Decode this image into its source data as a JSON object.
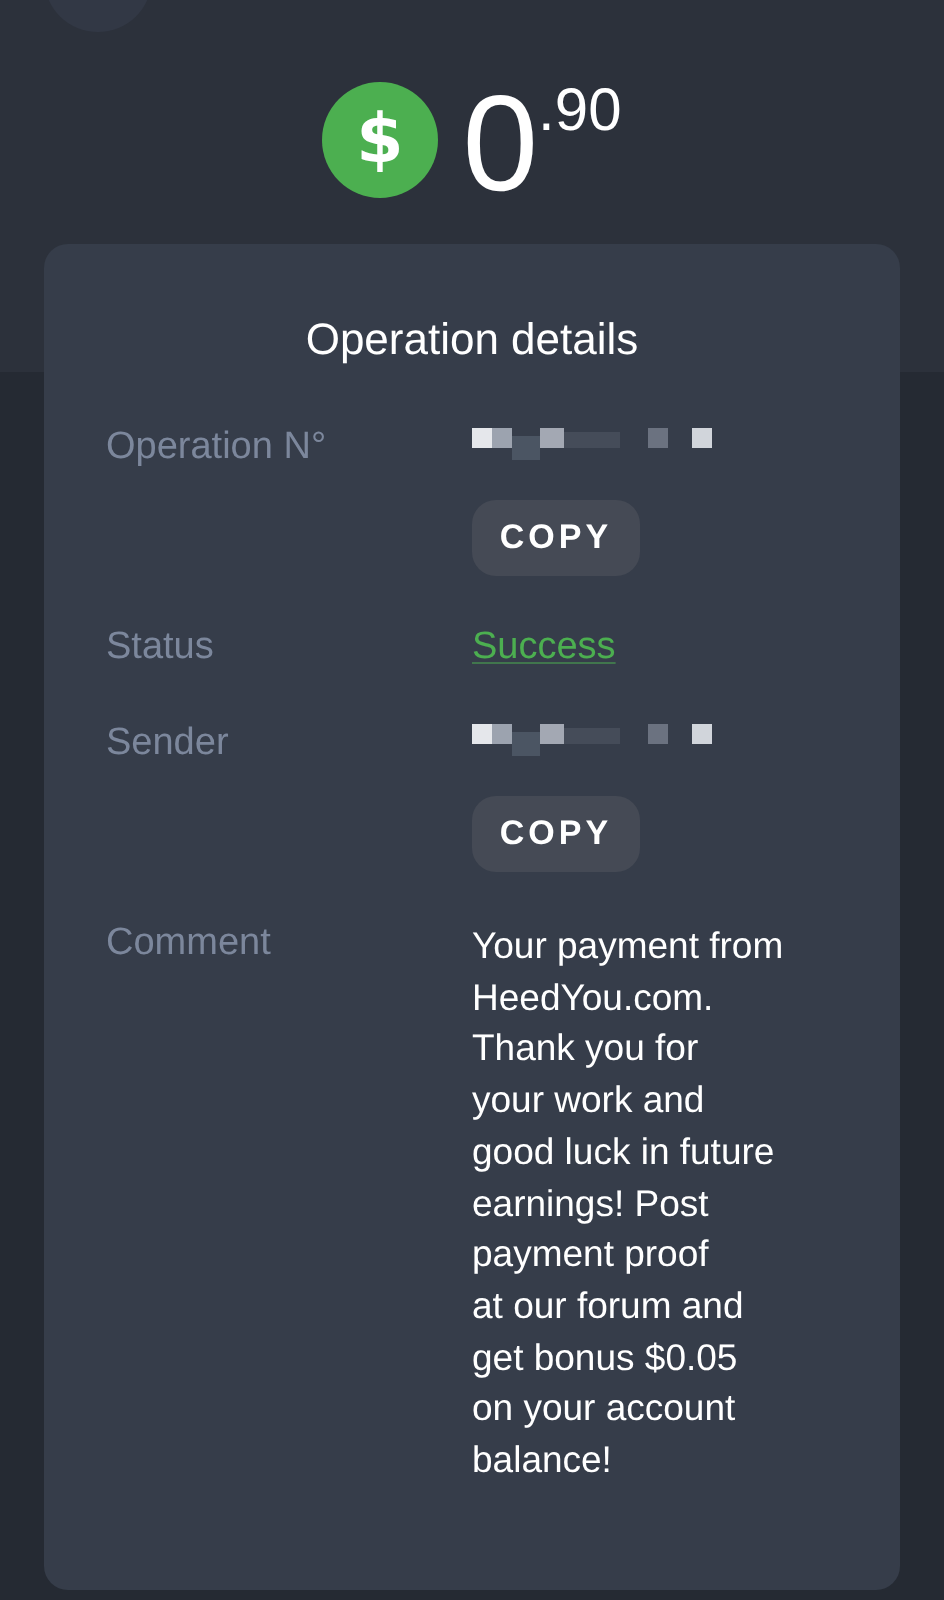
{
  "amount": {
    "currency_symbol": "$",
    "integer": "0",
    "fraction": ".90"
  },
  "card": {
    "title": "Operation details",
    "rows": [
      {
        "kind": "redacted",
        "label": "Operation N°",
        "copy": "COPY"
      },
      {
        "kind": "status",
        "label": "Status",
        "value": "Success"
      },
      {
        "kind": "redacted",
        "label": "Sender",
        "copy": "COPY"
      },
      {
        "kind": "text",
        "label": "Comment",
        "lines": [
          "Your payment from",
          "HeedYou.com.",
          "Thank you for",
          "your work and",
          "good luck in future",
          "earnings! Post",
          "payment proof",
          "at our forum and",
          "get bonus $0.05",
          "on your account",
          "balance!"
        ]
      }
    ]
  }
}
